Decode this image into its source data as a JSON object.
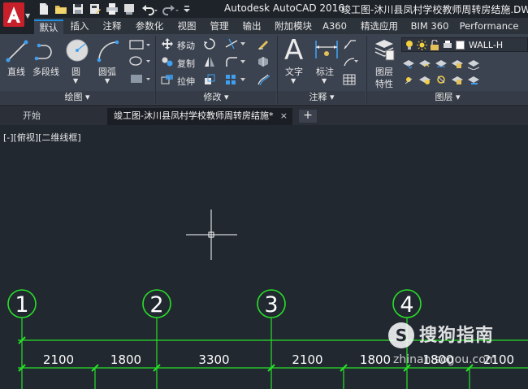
{
  "title_bar": {
    "app_title": "Autodesk AutoCAD 2016",
    "document_title": "竣工图-沐川县凤村学校教师周转房结施.DWG"
  },
  "ribbon_tabs": [
    "默认",
    "插入",
    "注释",
    "参数化",
    "视图",
    "管理",
    "输出",
    "附加模块",
    "A360",
    "精选应用",
    "BIM 360",
    "Performance"
  ],
  "active_tab": "默认",
  "draw_panel": {
    "title": "绘图",
    "line": "直线",
    "polyline": "多段线",
    "circle": "圆",
    "arc": "圆弧"
  },
  "modify_panel": {
    "title": "修改",
    "move": "移动",
    "copy": "复制",
    "stretch": "拉伸"
  },
  "annotation_panel": {
    "title": "注释",
    "text": "文字",
    "dimension": "标注"
  },
  "layers_panel": {
    "title": "图层",
    "properties_line1": "图层",
    "properties_line2": "特性",
    "current_layer": "WALL-H"
  },
  "document_tabs": {
    "start": "开始",
    "active": "竣工图-沐川县凤村学校教师周转房结施*",
    "close": "×",
    "add": "+"
  },
  "viewport_label": "[-][俯视][二维线框]",
  "drawing": {
    "grid_lines": [
      {
        "label": "1"
      },
      {
        "label": "2"
      },
      {
        "label": "3"
      },
      {
        "label": "4"
      }
    ],
    "dimensions": [
      "2100",
      "1800",
      "3300",
      "2100",
      "1800",
      "1800",
      "2100"
    ],
    "line_color": "#28e028"
  },
  "watermark": {
    "text": "搜狗指南",
    "url": "zhinan.sogou.com"
  },
  "colors": {
    "accent": "#1e8fe0",
    "app_logo": "#c8202a",
    "canvas": "#212830"
  }
}
